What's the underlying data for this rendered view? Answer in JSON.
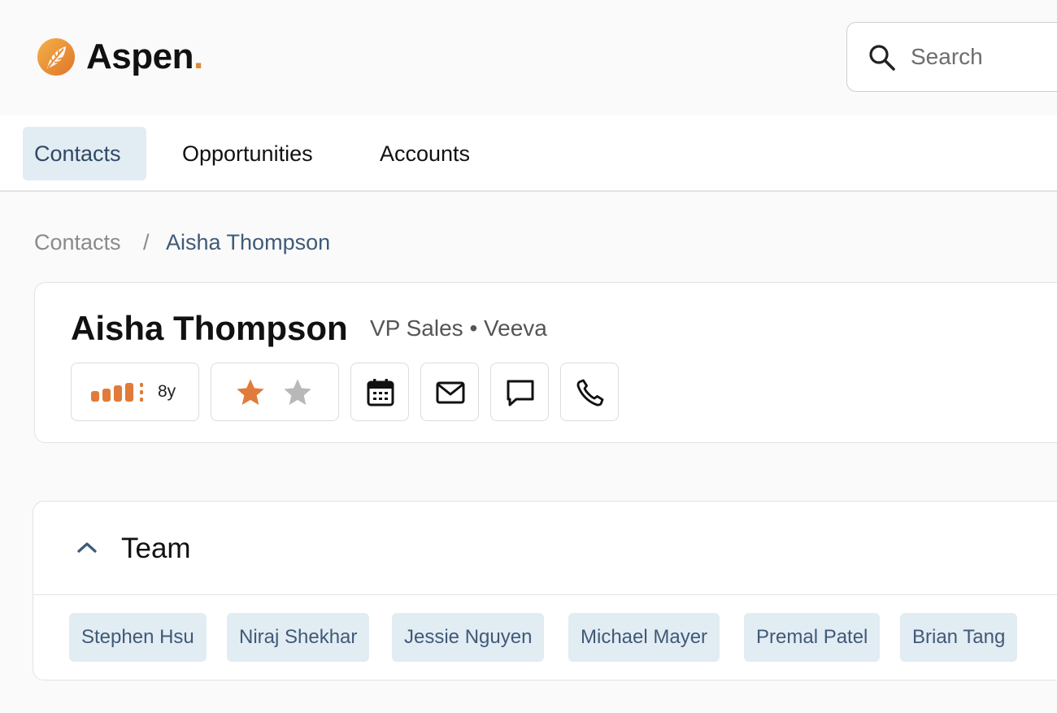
{
  "brand": {
    "name": "Aspen",
    "dot": ".",
    "accent": "#e08a3c"
  },
  "search": {
    "placeholder": "Search"
  },
  "nav": {
    "tabs": [
      {
        "label": "Contacts",
        "active": true
      },
      {
        "label": "Opportunities",
        "active": false
      },
      {
        "label": "Accounts",
        "active": false
      }
    ]
  },
  "breadcrumb": {
    "root": "Contacts",
    "separator": "/",
    "current": "Aisha Thompson"
  },
  "contact": {
    "name": "Aisha Thompson",
    "subtitle": "VP Sales • Veeva",
    "tenure": "8y",
    "rating": {
      "filled": 1,
      "total": 2
    },
    "actions": [
      "calendar-icon",
      "mail-icon",
      "chat-icon",
      "phone-icon"
    ]
  },
  "team": {
    "title": "Team",
    "members": [
      "Stephen Hsu",
      "Niraj Shekhar",
      "Jessie Nguyen",
      "Michael Mayer",
      "Premal Patel",
      "Brian Tang"
    ]
  },
  "colors": {
    "chip_bg": "#e2ecf3",
    "chip_text": "#3f5a78",
    "star": "#e07b39",
    "star_off": "#b8b8b8"
  }
}
